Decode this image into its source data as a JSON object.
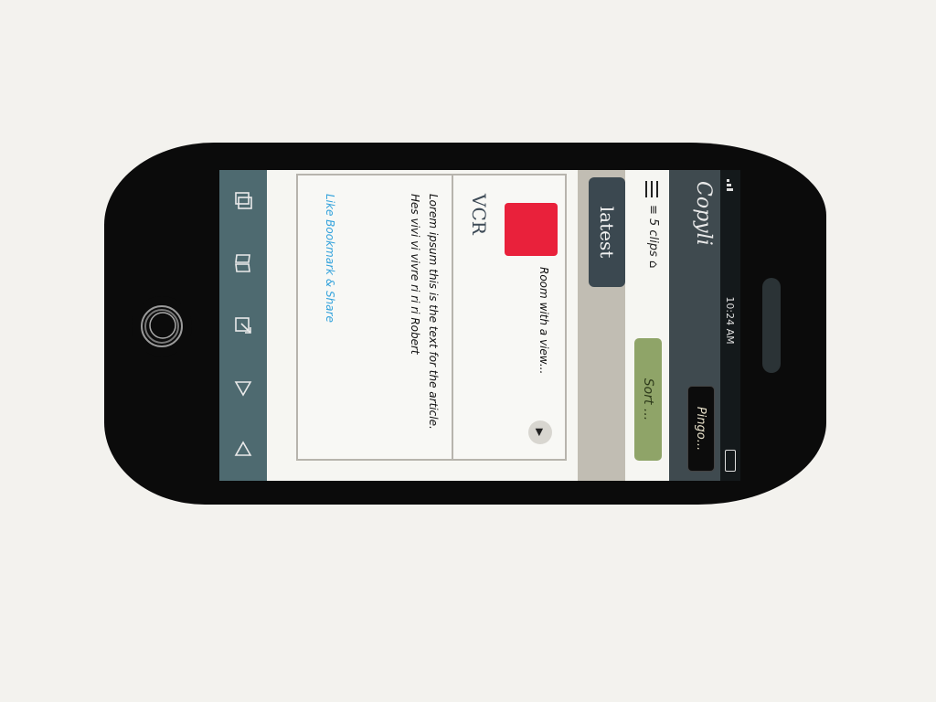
{
  "status_bar": {
    "time": "10:24 AM"
  },
  "navbar": {
    "title": "Copyli",
    "action_label": "Pingo..."
  },
  "subnav": {
    "info_text": "≡ 5 clips ⌂",
    "button_label": "Sort ..."
  },
  "tabs": {
    "latest_label": "latest"
  },
  "card": {
    "headline": "Room with a view...",
    "source": "VCR",
    "body": "Lorem ipsum this is the text for the article. Hes vivi vi vivre ri ri ri Robert",
    "links": "Like Bookmark & Share"
  },
  "tab_bar": {
    "icons": [
      "compose-icon",
      "play-icon",
      "share-icon",
      "book-icon",
      "copy-icon"
    ]
  },
  "colors": {
    "navbar": "#3f4a4f",
    "tab_active": "#3b4850",
    "green_button": "#8fa468",
    "thumbnail": "#e9213b",
    "link": "#35a3dc",
    "tab_bar": "#4e6a70"
  }
}
